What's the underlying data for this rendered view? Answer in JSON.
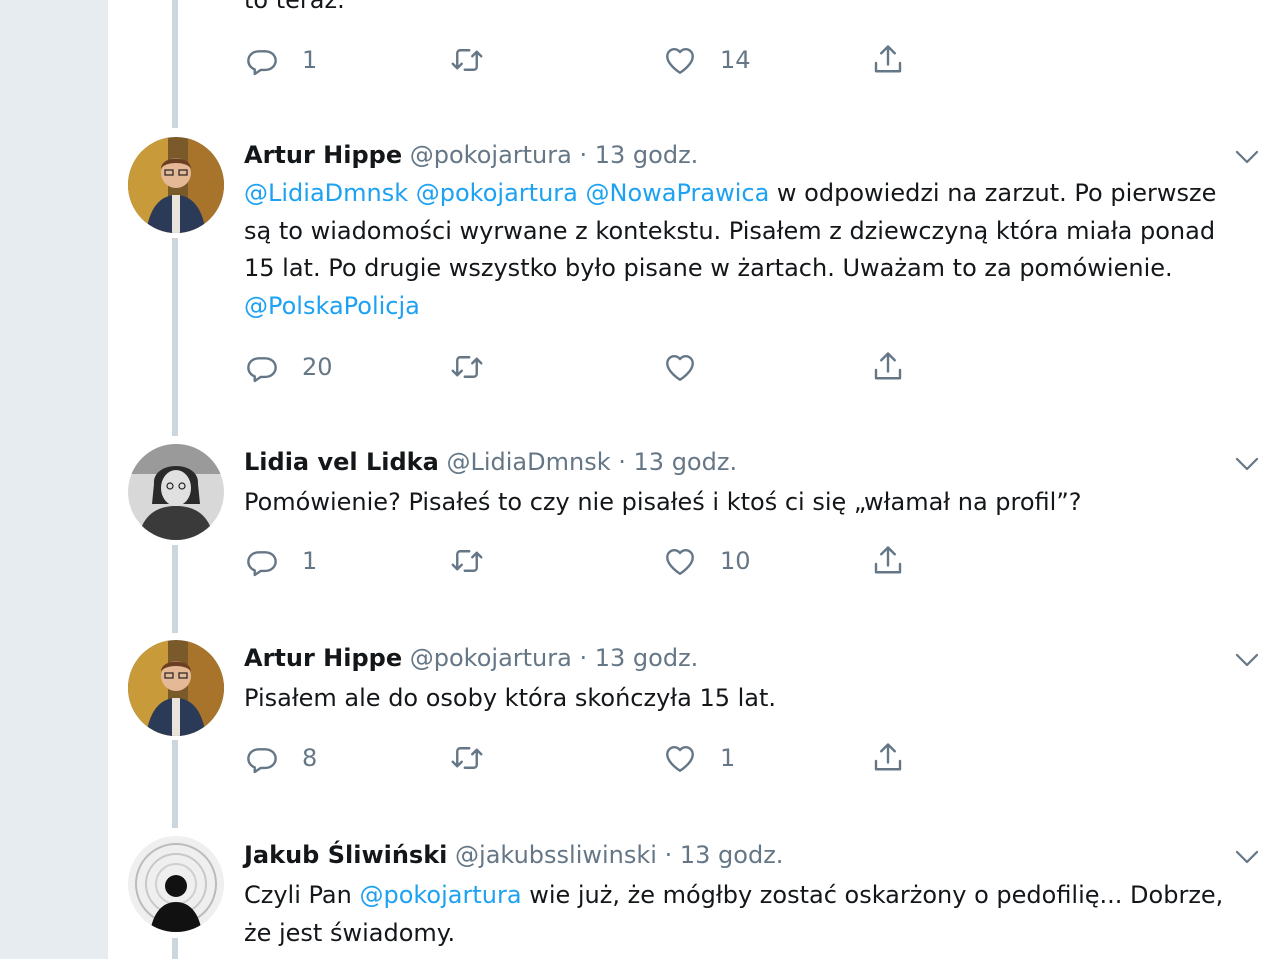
{
  "partial_top_text": "to teraz.",
  "tweets": [
    {
      "name": "",
      "handle": "",
      "time": "",
      "actions": {
        "reply_count": "1",
        "retweet_count": "",
        "like_count": "14"
      }
    },
    {
      "name": "Artur Hippe",
      "handle": "@pokojartura",
      "separator": "·",
      "time": "13 godz.",
      "body": [
        {
          "text": "@LidiaDmnsk",
          "mention": true
        },
        {
          "text": " ",
          "mention": false
        },
        {
          "text": "@pokojartura",
          "mention": true
        },
        {
          "text": " ",
          "mention": false
        },
        {
          "text": "@NowaPrawica",
          "mention": true
        },
        {
          "text": " w odpowiedzi na zarzut. Po pierwsze są to wiadomości wyrwane z kontekstu. Pisałem z dziewczyną która miała ponad 15 lat. Po drugie wszystko było pisane w żartach. Uważam to za pomówienie. ",
          "mention": false
        },
        {
          "text": "@PolskaPolicja",
          "mention": true
        }
      ],
      "actions": {
        "reply_count": "20",
        "retweet_count": "",
        "like_count": ""
      }
    },
    {
      "name": "Lidia vel Lidka",
      "handle": "@LidiaDmnsk",
      "separator": "·",
      "time": "13 godz.",
      "body": [
        {
          "text": "Pomówienie? Pisałeś to czy nie pisałeś i ktoś ci się „włamał na profil”?",
          "mention": false
        }
      ],
      "actions": {
        "reply_count": "1",
        "retweet_count": "",
        "like_count": "10"
      }
    },
    {
      "name": "Artur Hippe",
      "handle": "@pokojartura",
      "separator": "·",
      "time": "13 godz.",
      "body": [
        {
          "text": "Pisałem ale do osoby która skończyła 15 lat.",
          "mention": false
        }
      ],
      "actions": {
        "reply_count": "8",
        "retweet_count": "",
        "like_count": "1"
      }
    },
    {
      "name": "Jakub Śliwiński",
      "handle": "@jakubssliwinski",
      "separator": "·",
      "time": "13 godz.",
      "body": [
        {
          "text": "Czyli Pan ",
          "mention": false
        },
        {
          "text": "@pokojartura",
          "mention": true
        },
        {
          "text": " wie już, że mógłby zostać oskarżony o pedofilię... Dobrze, że jest świadomy.",
          "mention": false
        }
      ]
    }
  ],
  "icons": {
    "reply": "reply-icon",
    "retweet": "retweet-icon",
    "like": "heart-icon",
    "share": "share-icon",
    "caret": "chevron-down-icon"
  },
  "colors": {
    "mention": "#1da1f2",
    "meta": "#657786",
    "text": "#14171a",
    "gutter": "#e6ecf0",
    "thread_line": "#ccd6dd"
  }
}
